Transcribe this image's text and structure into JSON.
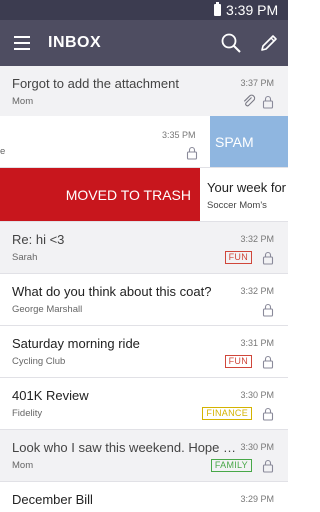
{
  "status_bar": {
    "time": "3:39 PM"
  },
  "app_bar": {
    "title": "INBOX"
  },
  "emails": [
    {
      "subject": "Forgot to add the attachment",
      "sender": "Mom",
      "time": "3:37 PM",
      "read": true,
      "attachment": true
    },
    {
      "subject": "Re: hi <3",
      "sender": "Sarah",
      "time": "3:32 PM",
      "read": true,
      "tag": "FUN"
    },
    {
      "subject": "What do you think about this coat?",
      "sender": "George Marshall",
      "time": "3:32 PM",
      "read": false
    },
    {
      "subject": "Saturday morning ride",
      "sender": "Cycling Club",
      "time": "3:31 PM",
      "read": false,
      "tag": "FUN"
    },
    {
      "subject": "401K Review",
      "sender": "Fidelity",
      "time": "3:30 PM",
      "read": false,
      "tag": "FINANCE"
    },
    {
      "subject": "Look who I saw this weekend. Hope you're",
      "sender": "Mom",
      "time": "3:30 PM",
      "read": true,
      "tag": "FAMILY"
    },
    {
      "subject": "December Bill",
      "sender": "",
      "time": "3:29 PM",
      "read": false
    }
  ],
  "swipe_spam": {
    "sender_fragment": "e",
    "time": "3:35 PM",
    "action_label": "SPAM"
  },
  "swipe_trash": {
    "action_label": "MOVED TO TRASH",
    "peek_subject": "Your week for",
    "peek_sender": "Soccer Mom's"
  },
  "colors": {
    "app_bar": "#4e4d61",
    "status_bar": "#3c3c50",
    "spam": "#8fb6e0",
    "trash": "#c8161d",
    "tag_fun": "#d0463a",
    "tag_finance": "#d4b300",
    "tag_family": "#48a848"
  }
}
